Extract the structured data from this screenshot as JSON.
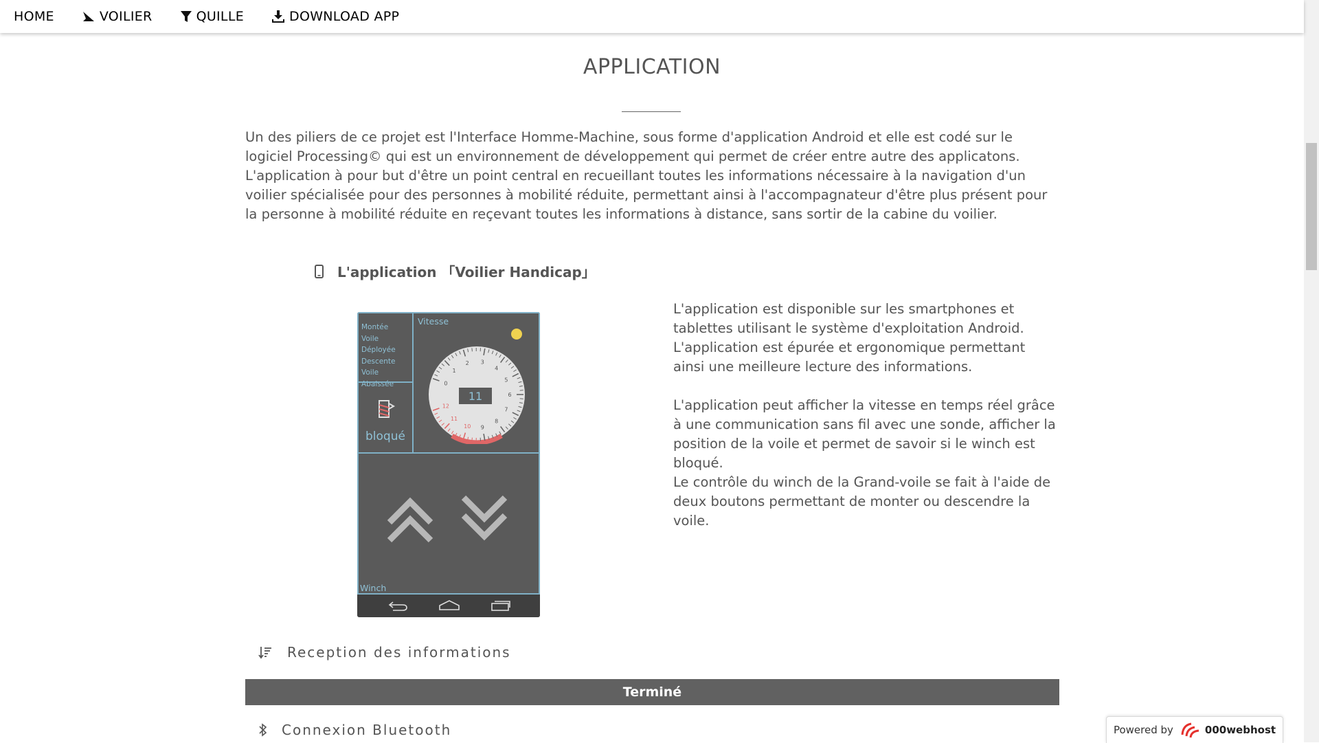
{
  "nav": {
    "home": "HOME",
    "voilier": "VOILIER",
    "quille": "QUILLE",
    "download": "DOWNLOAD APP"
  },
  "page": {
    "title": "APPLICATION",
    "intro": [
      "Un des piliers de ce projet est l'Interface Homme-Machine, sous forme d'application Android et elle est codé sur le logiciel Processing© qui est un environnement de développement qui permet de créer entre autre des applicatons.",
      "L'application à pour but d'être un point central en recueillant toutes les informations nécessaire à la navigation d'un voilier spécialisée pour des personnes à mobilité réduite, permettant ainsi à l'accompagnateur d'être plus présent pour la personne à mobilité réduite en reçevant toutes les informations à distance, sans sortir de la cabine du voilier."
    ]
  },
  "app_section": {
    "heading": "L'application 「Voilier Handicap」",
    "description": [
      "L'application est disponible sur les smartphones et tablettes utilisant le système d'exploitation Android.",
      "L'application est épurée et ergonomique permettant ainsi une meilleure lecture des informations.",
      "",
      "L'application peut afficher la vitesse en temps réel grâce à une communication sans fil avec une sonde, afficher la position de la voile et permet de savoir si le winch est bloqué.",
      "Le contrôle du winch de la Grand-voile se fait à l'aide de deux boutons permettant de monter ou descendre la voile."
    ]
  },
  "phone": {
    "status_lines": [
      "Montée",
      "Voile Déployée",
      "Descente",
      "Voile Abaissée"
    ],
    "vitesse_label": "Vitesse",
    "speed_value": "11",
    "gauge_ticks": [
      "0",
      "1",
      "2",
      "3",
      "4",
      "5",
      "6",
      "7",
      "8",
      "9",
      "10",
      "11",
      "12"
    ],
    "bloque_label": "bloqué",
    "winch_label": "Winch",
    "accent_color": "#8fc1d6",
    "indicator_color": "#f0d250"
  },
  "sections": {
    "reception": "Reception des informations",
    "progress_label": "Terminé",
    "bluetooth": "Connexion Bluetooth"
  },
  "footer": {
    "powered_by": "Powered by",
    "brand": "000webhost"
  }
}
